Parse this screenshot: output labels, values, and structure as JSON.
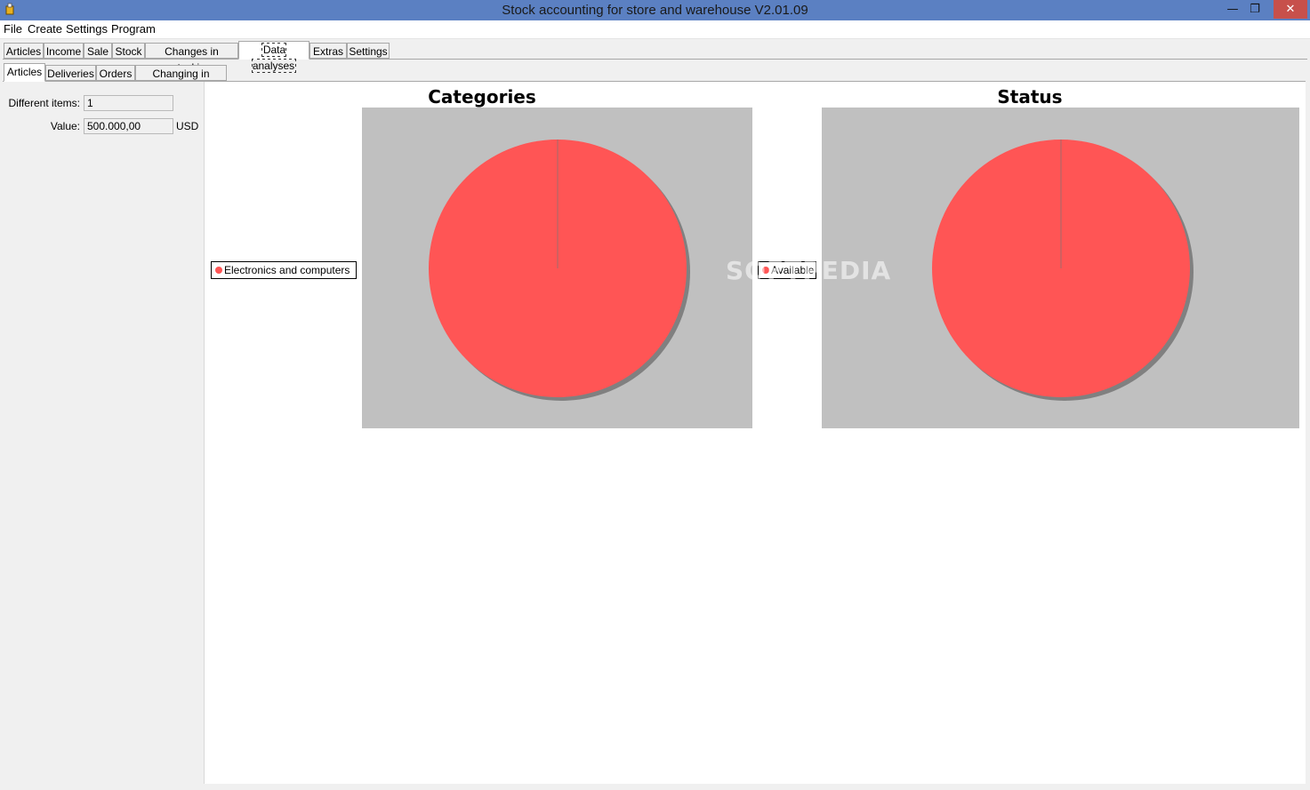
{
  "window": {
    "title": "Stock accounting for store and warehouse V2.01.09",
    "minimize_glyph": "—",
    "maximize_glyph": "❐",
    "close_glyph": "✕"
  },
  "menu": [
    "File",
    "Create",
    "Settings",
    "Program"
  ],
  "main_tabs": [
    {
      "label": "Articles",
      "active": false
    },
    {
      "label": "Income",
      "active": false
    },
    {
      "label": "Sale",
      "active": false
    },
    {
      "label": "Stock",
      "active": false
    },
    {
      "label": "Changes in stocking",
      "active": false
    },
    {
      "label": "Data analyses",
      "active": true
    },
    {
      "label": "Extras",
      "active": false
    },
    {
      "label": "Settings",
      "active": false
    }
  ],
  "sub_tabs": [
    {
      "label": "Articles",
      "active": true
    },
    {
      "label": "Deliveries",
      "active": false
    },
    {
      "label": "Orders",
      "active": false
    },
    {
      "label": "Changing in months",
      "active": false
    }
  ],
  "summary": {
    "different_items_label": "Different items:",
    "different_items_value": "1",
    "value_label": "Value:",
    "value_value": "500.000,00",
    "currency": "USD"
  },
  "watermark": "SOFTPEDIA",
  "colors": {
    "slice": "#ff5555",
    "plot_bg": "#c0c0c0",
    "shadow": "#808080"
  },
  "chart_data": [
    {
      "type": "pie",
      "title": "Categories",
      "slices": [
        {
          "label": "Electronics and computers",
          "value": 1,
          "share": 1.0
        }
      ]
    },
    {
      "type": "pie",
      "title": "Status",
      "slices": [
        {
          "label": "Available",
          "value": 1,
          "share": 1.0
        }
      ]
    }
  ]
}
